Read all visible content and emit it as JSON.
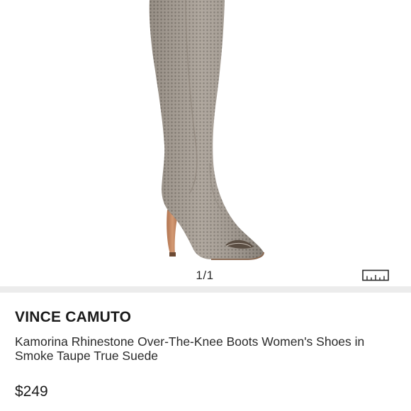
{
  "gallery": {
    "page_counter": "1/1",
    "image_alt": "Over-the-knee peep toe stiletto boot in perforated taupe suede",
    "size_chart_icon": "ruler-icon"
  },
  "product": {
    "brand": "VINCE CAMUTO",
    "title": "Kamorina Rhinestone Over-The-Knee Boots Women's Shoes in Smoke Taupe True Suede",
    "price": "$249"
  },
  "colors": {
    "suede": "#a49b91",
    "heel": "#c98a64",
    "divider": "#ececec",
    "text": "#1a1a1a"
  }
}
